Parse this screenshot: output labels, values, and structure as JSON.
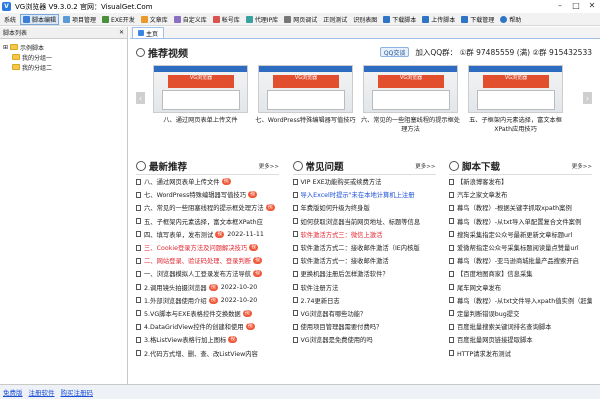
{
  "window": {
    "title": "VG浏览器 V9.3.0.2 官网：VisualGet.Com"
  },
  "toolbar": {
    "items": [
      "系统",
      "脚本编辑",
      "项目管理",
      "EXE开发",
      "文章库",
      "自定义库",
      "帐号库",
      "代理IP库",
      "网页调试",
      "正则测试",
      "识别表图",
      "下载脚本",
      "上传脚本",
      "下载管理",
      "帮助"
    ],
    "active_index": 1
  },
  "sidebar": {
    "title": "脚本列表",
    "items": [
      "示例脚本",
      "我的分组一",
      "我的分组二"
    ]
  },
  "tab": {
    "label": "主页"
  },
  "recommend": {
    "title": "推荐视频",
    "qq_button": "QQ交谈",
    "qq_groups": "加入QQ群： ①群 97485559 (满)  ②群 915432533",
    "cards": [
      {
        "banner": "VG浏览器",
        "caption": "八、通过网页表单上传文件"
      },
      {
        "banner": "VG浏览器",
        "caption": "七、WordPress特殊编辑器写值技巧"
      },
      {
        "banner": "VG浏览器",
        "caption": "六、常见的一些阻塞线程的提示框处理方法"
      },
      {
        "banner": "VG浏览器",
        "caption": "五、子框架内元素选择，富文本框XPath应用技巧"
      }
    ]
  },
  "latest": {
    "title": "最新推荐",
    "more": "更多>>",
    "items": [
      {
        "text": "八、通过网页表单上传文件",
        "hot": "视",
        "date": "",
        "style": "normal"
      },
      {
        "text": "七、WordPress特殊编辑器写值技巧",
        "hot": "视",
        "date": "",
        "style": "normal"
      },
      {
        "text": "六、常见的一些阻塞线程的提示框处理方法",
        "hot": "视",
        "date": "",
        "style": "normal"
      },
      {
        "text": "五、子框架内元素选择，富文本框XPath应",
        "hot": "",
        "date": "",
        "style": "normal"
      },
      {
        "text": "四、填写表单，发布测试",
        "hot": "视",
        "date": "2022-11-11",
        "style": "normal"
      },
      {
        "text": "三、Cookie登录方法及问题解决技巧",
        "hot": "视",
        "date": "",
        "style": "red"
      },
      {
        "text": "二、网站登录、验证码处理、登录判断",
        "hot": "视",
        "date": "",
        "style": "red"
      },
      {
        "text": "一、浏览器模拟人工登录发布方法导航",
        "hot": "视",
        "date": "",
        "style": "normal"
      },
      {
        "text": "2.调用镜头拍摄浏览器",
        "hot": "视",
        "date": "2022-10-20",
        "style": "normal"
      },
      {
        "text": "1.外部浏览器使用介绍",
        "hot": "视",
        "date": "2022-10-20",
        "style": "normal"
      },
      {
        "text": "5.VG脚本与EXE表格控件交换数据",
        "hot": "视",
        "date": "",
        "style": "normal"
      },
      {
        "text": "4.DataGridView控件的创建和使用",
        "hot": "视",
        "date": "",
        "style": "normal"
      },
      {
        "text": "3.格ListView表格行加上图标",
        "hot": "视",
        "date": "",
        "style": "normal"
      },
      {
        "text": "2.代码方式增、删、查、改ListView内容",
        "hot": "",
        "date": "",
        "style": "normal"
      }
    ]
  },
  "faq": {
    "title": "常见问题",
    "more": "更多>>",
    "items": [
      {
        "text": "VIP EXE功能购买或续费方法",
        "style": "normal"
      },
      {
        "text": "导入Excel时提示\"未在本地计算机上注册",
        "style": "blue"
      },
      {
        "text": "年费版如何升级为终身版",
        "style": "normal"
      },
      {
        "text": "如何获取浏览器当前网页地址、标题等信息",
        "style": "normal"
      },
      {
        "text": "软件激活方式三：微信上激活",
        "style": "red"
      },
      {
        "text": "软件激活方式二：接收邮件激活（IE内核版",
        "style": "normal"
      },
      {
        "text": "软件激活方式一：接收邮件激活",
        "style": "normal"
      },
      {
        "text": "更换机器注册后怎样激活软件？",
        "style": "normal"
      },
      {
        "text": "软件注册方法",
        "style": "normal"
      },
      {
        "text": "2.74更新日志",
        "style": "normal"
      },
      {
        "text": "VG浏览器有哪些功能？",
        "style": "normal"
      },
      {
        "text": "使用项目管理器需要付费吗？",
        "style": "normal"
      },
      {
        "text": "VG浏览器是免费使用的吗",
        "style": "normal"
      }
    ]
  },
  "downloads": {
    "title": "脚本下载",
    "more": "更多>>",
    "items": [
      "【新浪博客发布】",
      "汽车之家文章发布",
      "幕鸟（教程）-根据关键字抓取xpath案例",
      "幕鸟（教程）-从txt导入单配置复合文件案例",
      "搜狗采集指定公众号最新更新文章标题url",
      "爱微帮指定公众号采集标题阅读量点赞量url",
      "幕鸟（教程）-亚马逊商城批量产品搜索开启",
      "【百度地图商家】信息采集",
      "尾车网文章发布",
      "幕鸟（教程）-从txt文件导入xpath值实例（赶集网",
      "定量判断错误bug提交",
      "百度批量搜索关键词排名查询脚本",
      "百度批量网页链接提取脚本",
      "HTTP请求发布测试"
    ]
  },
  "statusbar": {
    "links": [
      "免费版",
      "注册软件",
      "购买注册码"
    ]
  }
}
